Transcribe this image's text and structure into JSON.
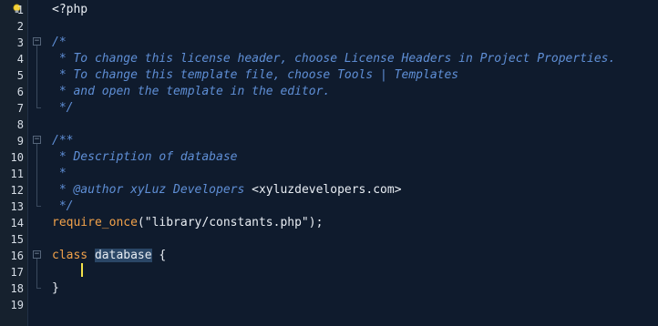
{
  "editor": {
    "lines": [
      {
        "n": "1",
        "segs": [
          {
            "t": "<?php",
            "c": "c-plain"
          }
        ]
      },
      {
        "n": "2",
        "segs": []
      },
      {
        "n": "3",
        "segs": [
          {
            "t": "/*",
            "c": "c-comment"
          }
        ]
      },
      {
        "n": "4",
        "segs": [
          {
            "t": " * To change this license header, choose License Headers in Project Properties.",
            "c": "c-comment"
          }
        ]
      },
      {
        "n": "5",
        "segs": [
          {
            "t": " * To change this template file, choose Tools | Templates",
            "c": "c-comment"
          }
        ]
      },
      {
        "n": "6",
        "segs": [
          {
            "t": " * and open the template in the editor.",
            "c": "c-comment"
          }
        ]
      },
      {
        "n": "7",
        "segs": [
          {
            "t": " */",
            "c": "c-comment"
          }
        ]
      },
      {
        "n": "8",
        "segs": []
      },
      {
        "n": "9",
        "segs": [
          {
            "t": "/**",
            "c": "c-comment"
          }
        ]
      },
      {
        "n": "10",
        "segs": [
          {
            "t": " * Description of database",
            "c": "c-comment"
          }
        ]
      },
      {
        "n": "11",
        "segs": [
          {
            "t": " *",
            "c": "c-comment"
          }
        ]
      },
      {
        "n": "12",
        "segs": [
          {
            "t": " * @author xyLuz Developers ",
            "c": "c-comment"
          },
          {
            "t": "<xyluzdevelopers.com>",
            "c": "c-tag"
          }
        ]
      },
      {
        "n": "13",
        "segs": [
          {
            "t": " */",
            "c": "c-comment"
          }
        ]
      },
      {
        "n": "14",
        "segs": [
          {
            "t": "require_once",
            "c": "c-kw"
          },
          {
            "t": "(\"library/constants.php\");",
            "c": "c-plain"
          }
        ]
      },
      {
        "n": "15",
        "segs": []
      },
      {
        "n": "16",
        "segs": [
          {
            "t": "class",
            "c": "c-kw"
          },
          {
            "t": " ",
            "c": "c-plain"
          },
          {
            "t": "database",
            "c": "c-sel"
          },
          {
            "t": " {",
            "c": "c-plain"
          }
        ]
      },
      {
        "n": "17",
        "segs": [
          {
            "t": "    ",
            "c": "c-plain"
          }
        ]
      },
      {
        "n": "18",
        "segs": [
          {
            "t": "}",
            "c": "c-plain"
          }
        ]
      },
      {
        "n": "19",
        "segs": []
      }
    ],
    "icons": {
      "hint": "lightbulb-icon"
    },
    "colors": {
      "background": "#0f1b2d",
      "gutter": "#16212e",
      "comment": "#5f8fd6",
      "keyword": "#f2a24a",
      "current_line": "#1b2e44",
      "caret": "#f3e24a"
    }
  }
}
